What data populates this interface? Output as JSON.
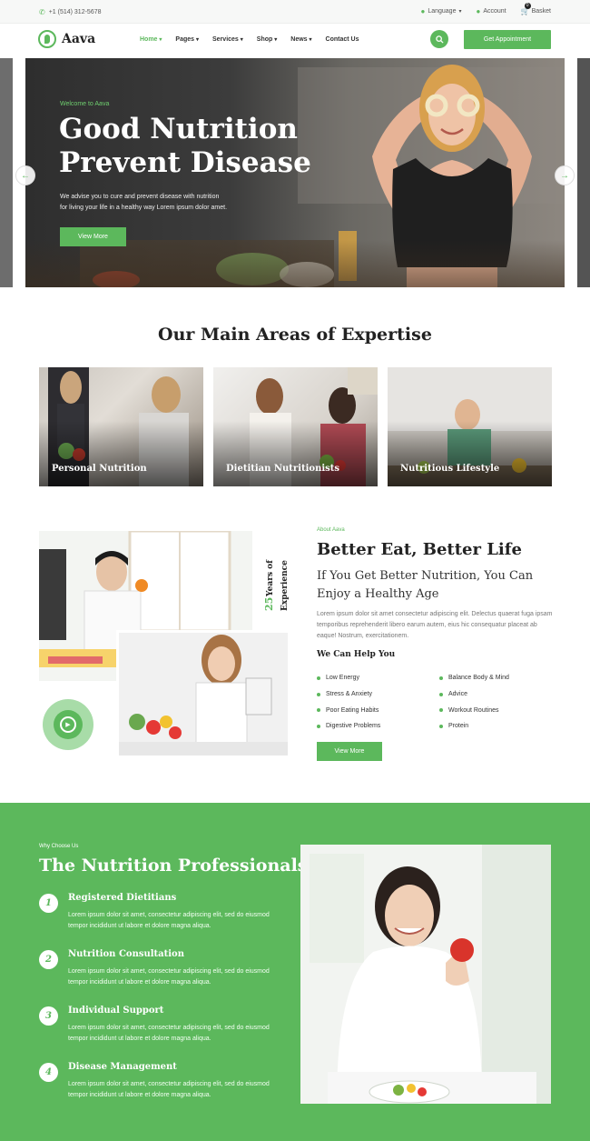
{
  "topbar": {
    "phone": "+1 (514) 312-5678",
    "language": "Language",
    "account": "Account",
    "basket": "Basket",
    "basket_count": "0"
  },
  "nav": {
    "brand": "Aava",
    "items": [
      {
        "label": "Home",
        "active": true
      },
      {
        "label": "Pages",
        "active": false
      },
      {
        "label": "Services",
        "active": false
      },
      {
        "label": "Shop",
        "active": false
      },
      {
        "label": "News",
        "active": false
      },
      {
        "label": "Contact Us",
        "active": false
      }
    ],
    "cta": "Get Appointment"
  },
  "hero": {
    "kicker": "Welcome to Aava",
    "title_line1": "Good Nutrition",
    "title_line2": "Prevent Disease",
    "desc_line1": "We advise you to cure and prevent disease with nutrition",
    "desc_line2": "for living your life in a healthy way Lorem ipsum dolor amet.",
    "button": "View More"
  },
  "expertise": {
    "title": "Our Main Areas of Expertise",
    "cards": [
      {
        "label": "Personal Nutrition"
      },
      {
        "label": "Dietitian Nutritionists"
      },
      {
        "label": "Nutritious Lifestyle"
      }
    ]
  },
  "about": {
    "years_num": "25",
    "years_text": "Years of",
    "years_text2": "Experience",
    "kicker": "About Aava",
    "title": "Better Eat, Better Life",
    "subtitle_line1": "If You Get Better Nutrition, You Can",
    "subtitle_line2": "Enjoy a Healthy Age",
    "paragraph": "Lorem ipsum dolor sit amet consectetur adipiscing elit. Delectus quaerat fuga ipsam temporibus reprehenderit libero earum autem, eius hic consequatur placeat ab eaque! Nostrum, exercitationem.",
    "help_title": "We Can Help You",
    "help_left": [
      "Low Energy",
      "Stress & Anxiety",
      "Poor Eating Habits",
      "Digestive Problems"
    ],
    "help_right": [
      "Balance Body & Mind",
      "Advice",
      "Workout Routines",
      "Protein"
    ],
    "button": "View More"
  },
  "why": {
    "kicker": "Why Choose Us",
    "title": "The Nutrition Professionals",
    "features": [
      {
        "num": "1",
        "title": "Registered Dietitians",
        "desc": "Lorem ipsum dolor sit amet, consectetur adipiscing elit, sed do eiusmod tempor incididunt ut labore et dolore magna aliqua."
      },
      {
        "num": "2",
        "title": "Nutrition Consultation",
        "desc": "Lorem ipsum dolor sit amet, consectetur adipiscing elit, sed do eiusmod tempor incididunt ut labore et dolore magna aliqua."
      },
      {
        "num": "3",
        "title": "Individual Support",
        "desc": "Lorem ipsum dolor sit amet, consectetur adipiscing elit, sed do eiusmod tempor incididunt ut labore et dolore magna aliqua."
      },
      {
        "num": "4",
        "title": "Disease Management",
        "desc": "Lorem ipsum dolor sit amet, consectetur adipiscing elit, sed do eiusmod tempor incididunt ut labore et dolore magna aliqua."
      }
    ]
  },
  "colors": {
    "accent": "#5cb85c",
    "dark_text": "#222222"
  },
  "icons": [
    "phone-icon",
    "globe-icon",
    "user-icon",
    "cart-icon",
    "search-icon",
    "arrow-left-icon",
    "arrow-right-icon",
    "play-icon"
  ]
}
